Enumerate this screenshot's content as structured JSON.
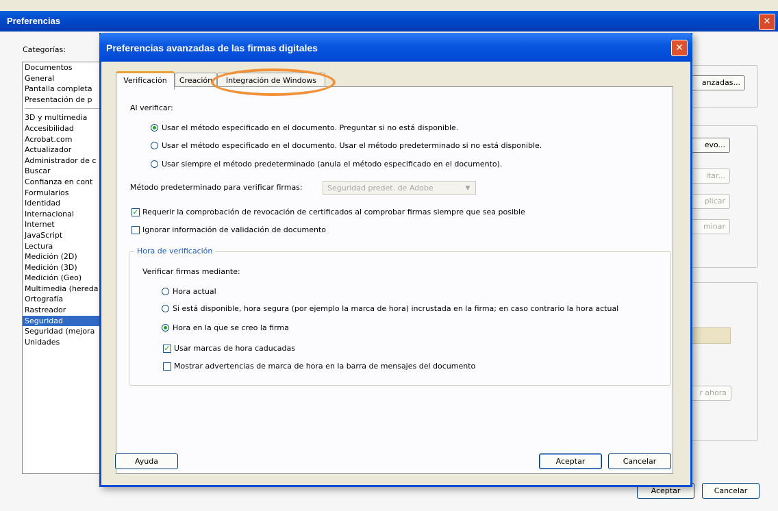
{
  "main_window": {
    "title": "Preferencias",
    "categories_label": "Categorías:",
    "categories_top": [
      "Documentos",
      "General",
      "Pantalla completa",
      "Presentación de p"
    ],
    "categories": [
      "3D y multimedia",
      "Accesibilidad",
      "Acrobat.com",
      "Actualizador",
      "Administrador de c",
      "Buscar",
      "Confianza en cont",
      "Formularios",
      "Identidad",
      "Internacional",
      "Internet",
      "JavaScript",
      "Lectura",
      "Medición (2D)",
      "Medición (3D)",
      "Medición (Geo)",
      "Multimedia (hereda",
      "Ortografía",
      "Rastreador",
      "Seguridad",
      "Seguridad (mejora",
      "Unidades"
    ],
    "selected_category": "Seguridad",
    "bg_buttons": {
      "advanced": "anzadas...",
      "new": "evo...",
      "edit": "itar...",
      "apply": "plicar",
      "delete": "minar",
      "update": "r ahora"
    },
    "ok_label": "Aceptar",
    "cancel_label": "Cancelar"
  },
  "dialog": {
    "title": "Preferencias avanzadas de las firmas digitales",
    "tabs": [
      {
        "label": "Verificación",
        "active": true
      },
      {
        "label": "Creación",
        "active": false
      },
      {
        "label": "Integración de Windows",
        "active": false
      }
    ],
    "on_verify_label": "Al verificar:",
    "verify_options": [
      {
        "label": "Usar el método especificado en el documento. Preguntar si no está disponible.",
        "selected": true
      },
      {
        "label": "Usar el método especificado en el documento. Usar el método predeterminado si no está disponible.",
        "selected": false
      },
      {
        "label": "Usar siempre el método predeterminado (anula el método especificado en el documento).",
        "selected": false
      }
    ],
    "default_method_label": "Método predeterminado para verificar firmas:",
    "default_method_value": "Seguridad predet. de Adobe",
    "checkbox_revocation": {
      "label": "Requerir la comprobación de revocación de certificados al comprobar firmas siempre que sea posible",
      "checked": true
    },
    "checkbox_ignore": {
      "label": "Ignorar información de validación de documento",
      "checked": false
    },
    "time_group": {
      "title": "Hora de verificación",
      "subtitle": "Verificar firmas mediante:",
      "options": [
        {
          "label": "Hora actual",
          "selected": false
        },
        {
          "label": "Si está disponible, hora segura (por ejemplo la marca de hora) incrustada en la firma; en caso contrario la hora actual",
          "selected": false
        },
        {
          "label": "Hora en la que se creo la firma",
          "selected": true
        }
      ],
      "checkbox_expired": {
        "label": "Usar marcas de hora caducadas",
        "checked": true
      },
      "checkbox_warnings": {
        "label": "Mostrar advertencias de marca de hora en la barra de mensajes del documento",
        "checked": false
      }
    },
    "help_label": "Ayuda",
    "ok_label": "Aceptar",
    "cancel_label": "Cancelar"
  },
  "colors": {
    "titlebar_blue": "#0a58e0",
    "selection_blue": "#316ac5",
    "highlight_orange": "#f0923c",
    "group_title_blue": "#1d5bbb"
  }
}
